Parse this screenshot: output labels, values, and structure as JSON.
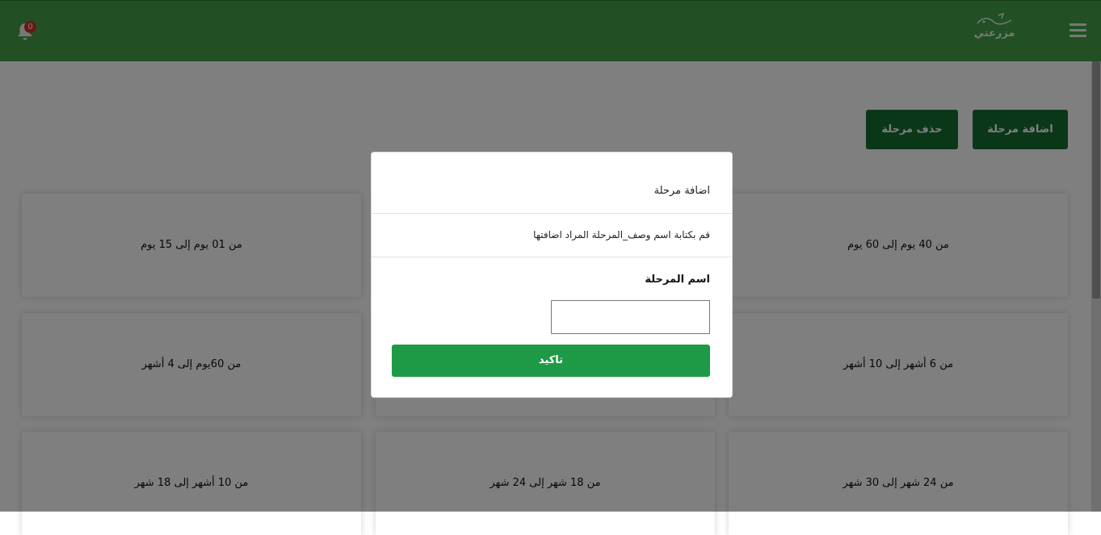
{
  "header": {
    "logo_text": "مزرعتي",
    "notification_count": "0",
    "logo_icon": "farm-logo-icon",
    "menu_icon": "hamburger-menu-icon",
    "bell_icon": "bell-icon"
  },
  "toolbar": {
    "add_stage_label": "اضافة مرحلة",
    "delete_stage_label": "حذف مرحلة"
  },
  "stages": [
    {
      "label": "من 40 يوم إلى 60 يوم"
    },
    {
      "label": "من 01 يوم إلى 15 يوم"
    },
    {
      "label": "من 6 أشهر إلى 10 أشهر"
    },
    {
      "label": "من 60يوم إلى 4 أشهر"
    },
    {
      "label": "من 24 شهر إلى 30 شهر"
    },
    {
      "label": "من 18 شهر إلى 24 شهر"
    },
    {
      "label": "من 10 أشهر إلى 18 شهر"
    }
  ],
  "modal": {
    "title": "اضافة مرحلة",
    "description": "قم بكتابة اسم وصف_المرحلة المراد اضافتها",
    "field_label": "اسم المرحلة",
    "field_value": "",
    "confirm_label": "تاكيد"
  },
  "colors": {
    "header_green": "#45a049",
    "button_dark_green": "#166f33",
    "confirm_green": "#1e9a47",
    "badge_red": "#d32f2f"
  }
}
